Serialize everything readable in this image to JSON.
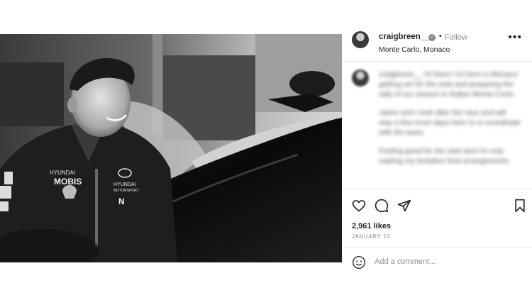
{
  "post": {
    "username": "craigbreen__",
    "verified_icon": "verified-badge-icon",
    "separator": "•",
    "follow_label": "Follow",
    "location": "Monte Carlo, Monaco",
    "more_icon": "more-options-icon",
    "more_label": "•••"
  },
  "caption": {
    "paragraphs": [
      "craigbreen__ Hi there! I'm here in Monaco getting set for the start and preparing the rally of our season in Rallye Monte-Carlo.",
      "Jaime and I look after the race and will stay a few more days here to re-coordinate with the team.",
      "Feeling good for the start and I'm only making my tentative final arrangements."
    ]
  },
  "actions": {
    "like_icon": "heart-icon",
    "comment_icon": "comment-icon",
    "share_icon": "share-icon",
    "save_icon": "bookmark-icon"
  },
  "likes": "2,961 likes",
  "date": "JANUARY 10",
  "comment_box": {
    "emoji_icon": "emoji-icon",
    "placeholder": "Add a comment..."
  },
  "colors": {
    "text": "#262626",
    "muted": "#8e8e8e",
    "divider": "#efefef"
  }
}
